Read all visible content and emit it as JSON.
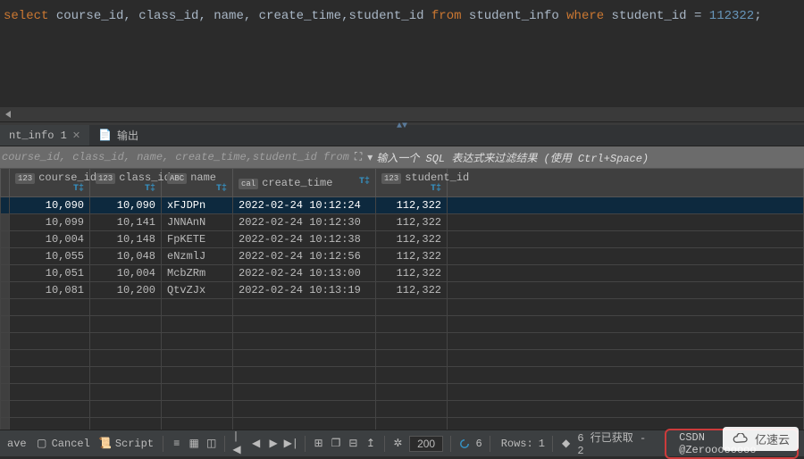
{
  "sql": {
    "kw_select": "select",
    "cols": " course_id, class_id, name, create_time,student_id ",
    "kw_from": "from",
    "table": " student_info ",
    "kw_where": "where",
    "cond_col": " student_id ",
    "eq": "= ",
    "cond_val": "112322",
    "semi": ";"
  },
  "tabs": {
    "result": {
      "label": "nt_info 1"
    },
    "output": {
      "label": "输出"
    }
  },
  "filter": {
    "query_echo": "course_id, class_id, name, create_time,student_id from",
    "placeholder": "输入一个 SQL 表达式来过滤结果 (使用 Ctrl+Space)"
  },
  "columns": [
    {
      "type": "123",
      "name": "course_id"
    },
    {
      "type": "123",
      "name": "class_id"
    },
    {
      "type": "ABC",
      "name": "name"
    },
    {
      "type": "cal",
      "name": "create_time"
    },
    {
      "type": "123",
      "name": "student_id"
    }
  ],
  "rows": [
    {
      "course_id": "10,090",
      "class_id": "10,090",
      "name": "xFJDPn",
      "create_time": "2022-02-24 10:12:24",
      "student_id": "112,322"
    },
    {
      "course_id": "10,099",
      "class_id": "10,141",
      "name": "JNNAnN",
      "create_time": "2022-02-24 10:12:30",
      "student_id": "112,322"
    },
    {
      "course_id": "10,004",
      "class_id": "10,148",
      "name": "FpKETE",
      "create_time": "2022-02-24 10:12:38",
      "student_id": "112,322"
    },
    {
      "course_id": "10,055",
      "class_id": "10,048",
      "name": "eNzmlJ",
      "create_time": "2022-02-24 10:12:56",
      "student_id": "112,322"
    },
    {
      "course_id": "10,051",
      "class_id": "10,004",
      "name": "McbZRm",
      "create_time": "2022-02-24 10:13:00",
      "student_id": "112,322"
    },
    {
      "course_id": "10,081",
      "class_id": "10,200",
      "name": "QtvZJx",
      "create_time": "2022-02-24 10:13:19",
      "student_id": "112,322"
    }
  ],
  "toolbar": {
    "save": "ave",
    "cancel": "Cancel",
    "script": "Script",
    "page_size": "200",
    "refresh_count": "6",
    "rows_label": "Rows:",
    "rows_value": "1",
    "fetched": "6 行已获取 - 2",
    "csdn": "CSDN @Zeroooooooo"
  },
  "watermark": "亿速云"
}
